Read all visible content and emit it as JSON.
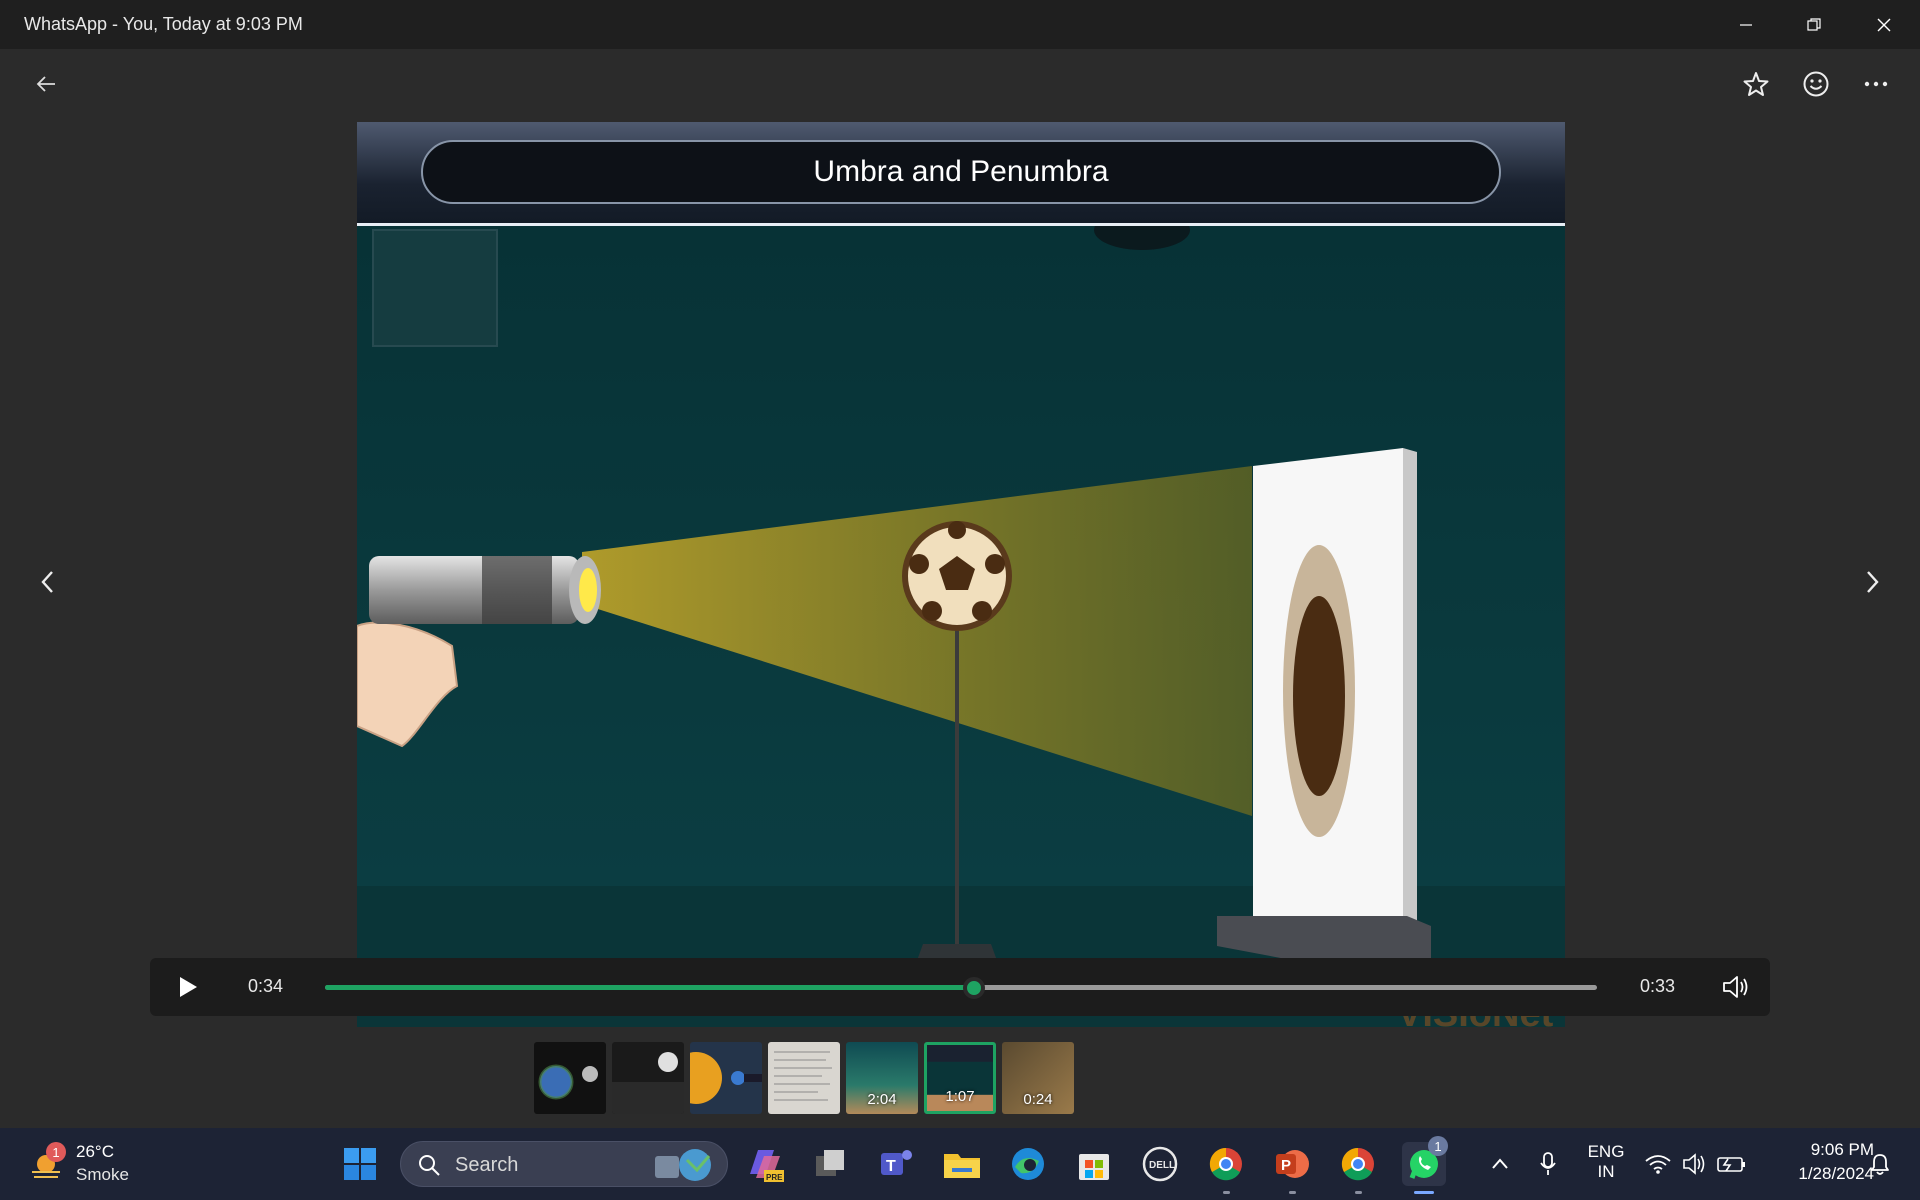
{
  "window": {
    "title": "WhatsApp - You, Today at 9:03 PM"
  },
  "toolbar": {
    "back": "back-arrow-icon",
    "star": "star-icon",
    "react": "smiley-icon",
    "more": "more-icon"
  },
  "video": {
    "heading": "Umbra and Penumbra",
    "watermark": "VISIoNet"
  },
  "player": {
    "current_time": "0:34",
    "remaining_time": "0:33",
    "progress_percent": 51,
    "accent_color": "#1ea362"
  },
  "thumbnails": [
    {
      "kind": "image",
      "duration": ""
    },
    {
      "kind": "image",
      "duration": ""
    },
    {
      "kind": "image",
      "duration": ""
    },
    {
      "kind": "image",
      "duration": ""
    },
    {
      "kind": "video",
      "duration": "2:04"
    },
    {
      "kind": "video",
      "duration": "1:07",
      "active": true
    },
    {
      "kind": "video",
      "duration": "0:24"
    }
  ],
  "taskbar": {
    "weather_temp": "26°C",
    "weather_condition": "Smoke",
    "weather_badge": "1",
    "search_label": "Search",
    "whatsapp_badge": "1",
    "language_line1": "ENG",
    "language_line2": "IN",
    "clock_time": "9:06 PM",
    "clock_date": "1/28/2024"
  }
}
